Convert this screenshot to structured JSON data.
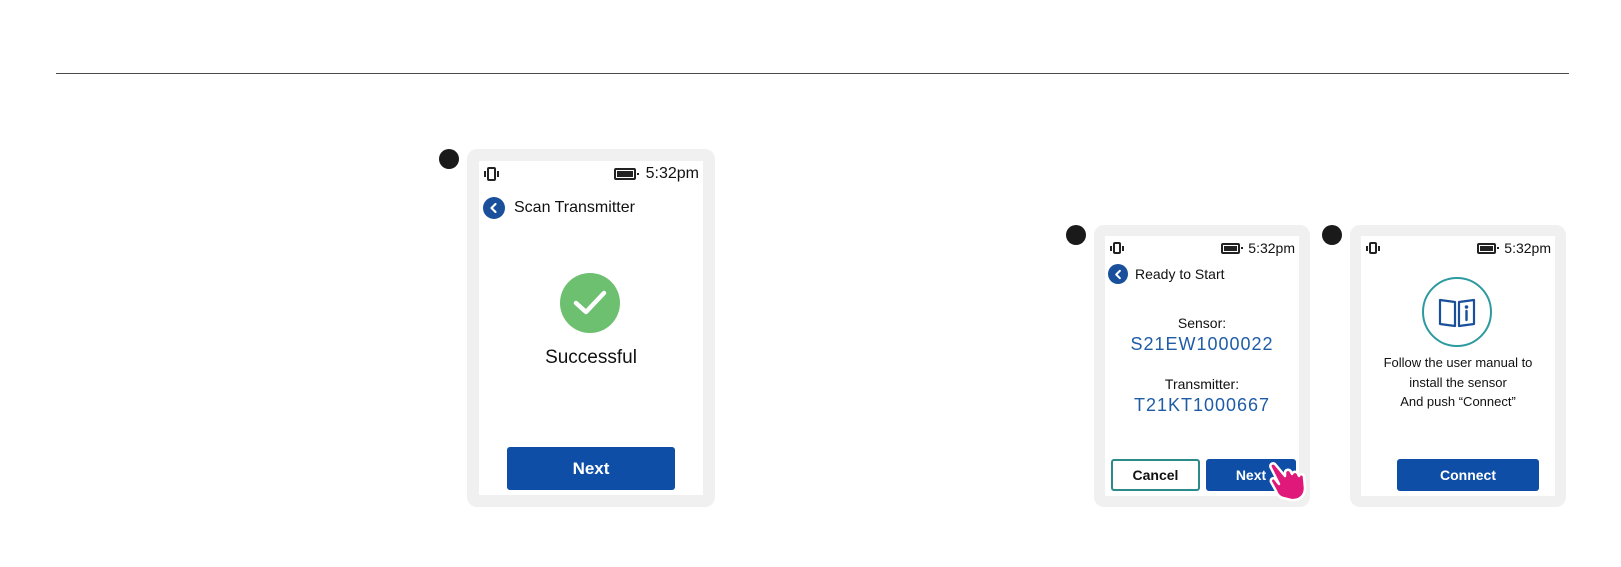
{
  "status": {
    "time": "5:32pm"
  },
  "screen1": {
    "title": "Scan Transmitter",
    "result": "Successful",
    "next_label": "Next"
  },
  "screen2": {
    "title": "Ready to Start",
    "sensor_label": "Sensor:",
    "sensor_value": "S21EW1000022",
    "transmitter_label": "Transmitter:",
    "transmitter_value": "T21KT1000667",
    "cancel_label": "Cancel",
    "next_label": "Next"
  },
  "screen3": {
    "line1": "Follow the user manual to",
    "line2": "install the sensor",
    "line3": "And push “Connect”",
    "connect_label": "Connect"
  },
  "icons": {
    "vibrate": "vibrate-icon",
    "battery": "battery-icon",
    "back": "back-arrow-icon",
    "success": "checkmark-circle-icon",
    "manual": "manual-info-icon",
    "hand": "pointing-hand-icon"
  },
  "colors": {
    "primary": "#0e4ea6",
    "success": "#6cc06f",
    "outline": "#2d8a8a",
    "hand": "#e0187a",
    "value": "#1f5ca8"
  }
}
